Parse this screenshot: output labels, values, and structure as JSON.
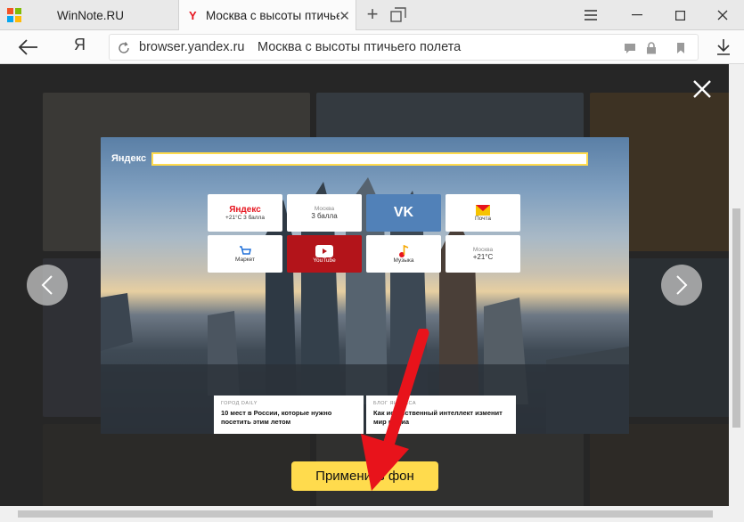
{
  "tabs": {
    "inactive_title": "WinNote.RU",
    "active_title": "Москва с высоты птичье"
  },
  "address": {
    "host": "browser.yandex.ru",
    "page_title": "Москва с высоты птичьего полета",
    "ya_label": "Я"
  },
  "preview": {
    "logo": "Яндекс",
    "tiles": [
      {
        "top": "",
        "main": "Яндекс",
        "sub": "+21°C   3 балла"
      },
      {
        "top": "Москва",
        "main": "3 балла",
        "sub": ""
      },
      {
        "top": "",
        "main": "VK",
        "sub": ""
      },
      {
        "top": "",
        "main": "",
        "sub": "Почта"
      },
      {
        "top": "",
        "main": "",
        "sub": "Маркет"
      },
      {
        "top": "",
        "main": "",
        "sub": "YouTube"
      },
      {
        "top": "",
        "main": "",
        "sub": "Музыка"
      },
      {
        "top": "Москва",
        "main": "+21°C",
        "sub": ""
      }
    ],
    "news": [
      {
        "tag": "ГОРОД DAILY",
        "text": "10 мест в России, которые нужно посетить этим летом"
      },
      {
        "tag": "БЛОГ ЯНДЕКСА",
        "text": "Как искусственный интеллект изменит мир медиа"
      }
    ]
  },
  "apply_button_label": "Применить фон",
  "icons": {
    "close": "close-icon",
    "prev": "chevron-left-icon",
    "next": "chevron-right-icon",
    "download": "download-icon"
  },
  "colors": {
    "accent": "#ffdb4d",
    "arrow": "#e8131b"
  }
}
